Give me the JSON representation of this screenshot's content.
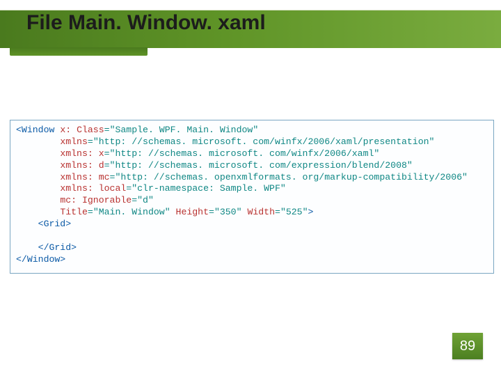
{
  "title": "File Main. Window. xaml",
  "page_number": "89",
  "colors": {
    "header_gradient_start": "#4a7a1e",
    "header_gradient_end": "#7aac3f",
    "code_border": "#7aa6c2",
    "kw_blue": "#0b5aa6",
    "attr_red": "#b8312f",
    "val_teal": "#0f8784"
  },
  "code": {
    "l1_open": "<Window",
    "l1_attr": "x: Class",
    "l1_eq": "=",
    "l1_val": "\"Sample. WPF. Main. Window\"",
    "l2_attr": "xmlns",
    "l2_eq": "=",
    "l2_val": "\"http: //schemas. microsoft. com/winfx/2006/xaml/presentation\"",
    "l3_attr": "xmlns: x",
    "l3_eq": "=",
    "l3_val": "\"http: //schemas. microsoft. com/winfx/2006/xaml\"",
    "l4_attr": "xmlns: d",
    "l4_eq": "=",
    "l4_val": "\"http: //schemas. microsoft. com/expression/blend/2008\"",
    "l5_attr": "xmlns: mc",
    "l5_eq": "=",
    "l5_val": "\"http: //schemas. openxmlformats. org/markup-compatibility/2006\"",
    "l6_attr": "xmlns: local",
    "l6_eq": "=",
    "l6_val": "\"clr-namespace: Sample. WPF\"",
    "l7_attr": "mc: Ignorable",
    "l7_eq": "=",
    "l7_val": "\"d\"",
    "l8_attr1": "Title",
    "l8_val1": "\"Main. Window\"",
    "l8_attr2": "Height",
    "l8_val2": "\"350\"",
    "l8_attr3": "Width",
    "l8_val3": "\"525\"",
    "l8_close": ">",
    "l9": "<Grid>",
    "l10": "</Grid>",
    "l11": "</Window>"
  }
}
